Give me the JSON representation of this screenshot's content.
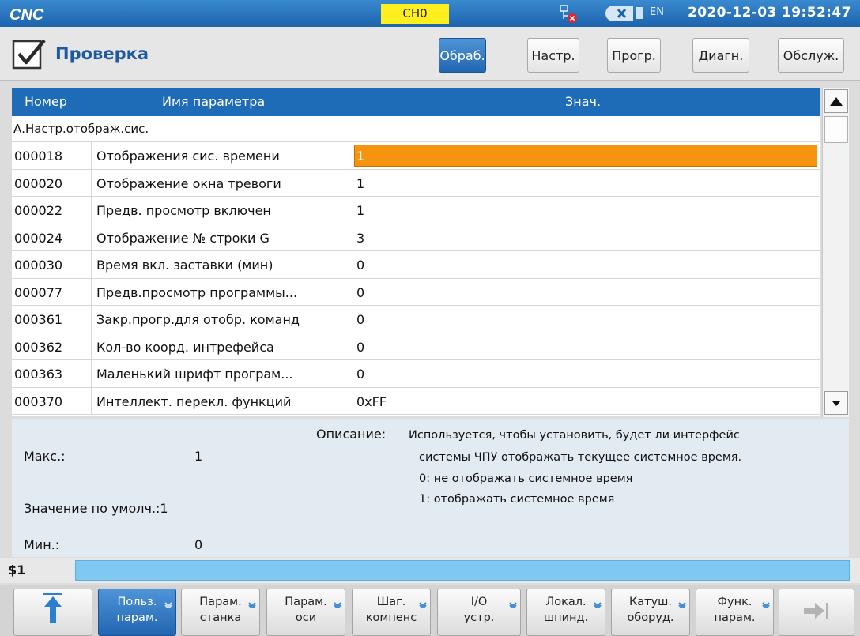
{
  "statusbar": {
    "logo_text": "CNC",
    "channel": "CH0",
    "lang": "EN",
    "datetime": "2020-12-03 19:52:47"
  },
  "title": {
    "page_title": "Проверка",
    "tabs": [
      {
        "label": "Обраб.",
        "active": true
      },
      {
        "label": "Настр.",
        "active": false
      },
      {
        "label": "Прогр.",
        "active": false
      },
      {
        "label": "Диагн.",
        "active": false
      },
      {
        "label": "Обслуж.",
        "active": false
      }
    ]
  },
  "table": {
    "headers": {
      "num": "Номер",
      "name": "Имя параметра",
      "value": "Знач."
    },
    "group": "А.Настр.отображ.сис.",
    "rows": [
      {
        "num": "000018",
        "name": "Отображения сис. времени",
        "value": "1",
        "selected": true
      },
      {
        "num": "000020",
        "name": "Отображение окна тревоги",
        "value": "1"
      },
      {
        "num": "000022",
        "name": "Предв. просмотр включен",
        "value": "1"
      },
      {
        "num": "000024",
        "name": "Отображение № строки G",
        "value": "3"
      },
      {
        "num": "000030",
        "name": "Время вкл. заставки (мин)",
        "value": "0"
      },
      {
        "num": "000077",
        "name": "Предв.просмотр программы...",
        "value": "0"
      },
      {
        "num": "000361",
        "name": "Закр.прогр.для отобр. команд",
        "value": "0"
      },
      {
        "num": "000362",
        "name": "Кол-во коорд. интрефейса",
        "value": "0"
      },
      {
        "num": "000363",
        "name": "Маленький шрифт програм...",
        "value": "0"
      },
      {
        "num": "000370",
        "name": "Интеллект. перекл. функций",
        "value": "0xFF"
      }
    ]
  },
  "info": {
    "max_label": "Макс.:",
    "max_value": "1",
    "default_label": "Значение по умолч.:1",
    "min_label": "Мин.:",
    "min_value": "0",
    "desc_label": "Описание:",
    "desc_lines": [
      "Используется, чтобы установить, будет ли интерфейс",
      "системы ЧПУ отображать текущее системное время.",
      "0: не отображать системное время",
      "1: отображать системное время"
    ]
  },
  "cmdline": {
    "prompt": "$1"
  },
  "softkeys": [
    {
      "l1": "Польз.",
      "l2": "парам.",
      "active": true
    },
    {
      "l1": "Парам.",
      "l2": "станка"
    },
    {
      "l1": "Парам.",
      "l2": "оси"
    },
    {
      "l1": "Шаг.",
      "l2": "компенс"
    },
    {
      "l1": "I/O",
      "l2": "устр."
    },
    {
      "l1": "Локал.",
      "l2": "шпинд."
    },
    {
      "l1": "Катуш.",
      "l2": "оборуд."
    },
    {
      "l1": "Функ.",
      "l2": "парам."
    }
  ],
  "colors": {
    "accent": "#1e6bb8",
    "selection": "#f7940f",
    "channel_badge": "#ffef1e",
    "cmd_input": "#7ec8f1"
  }
}
